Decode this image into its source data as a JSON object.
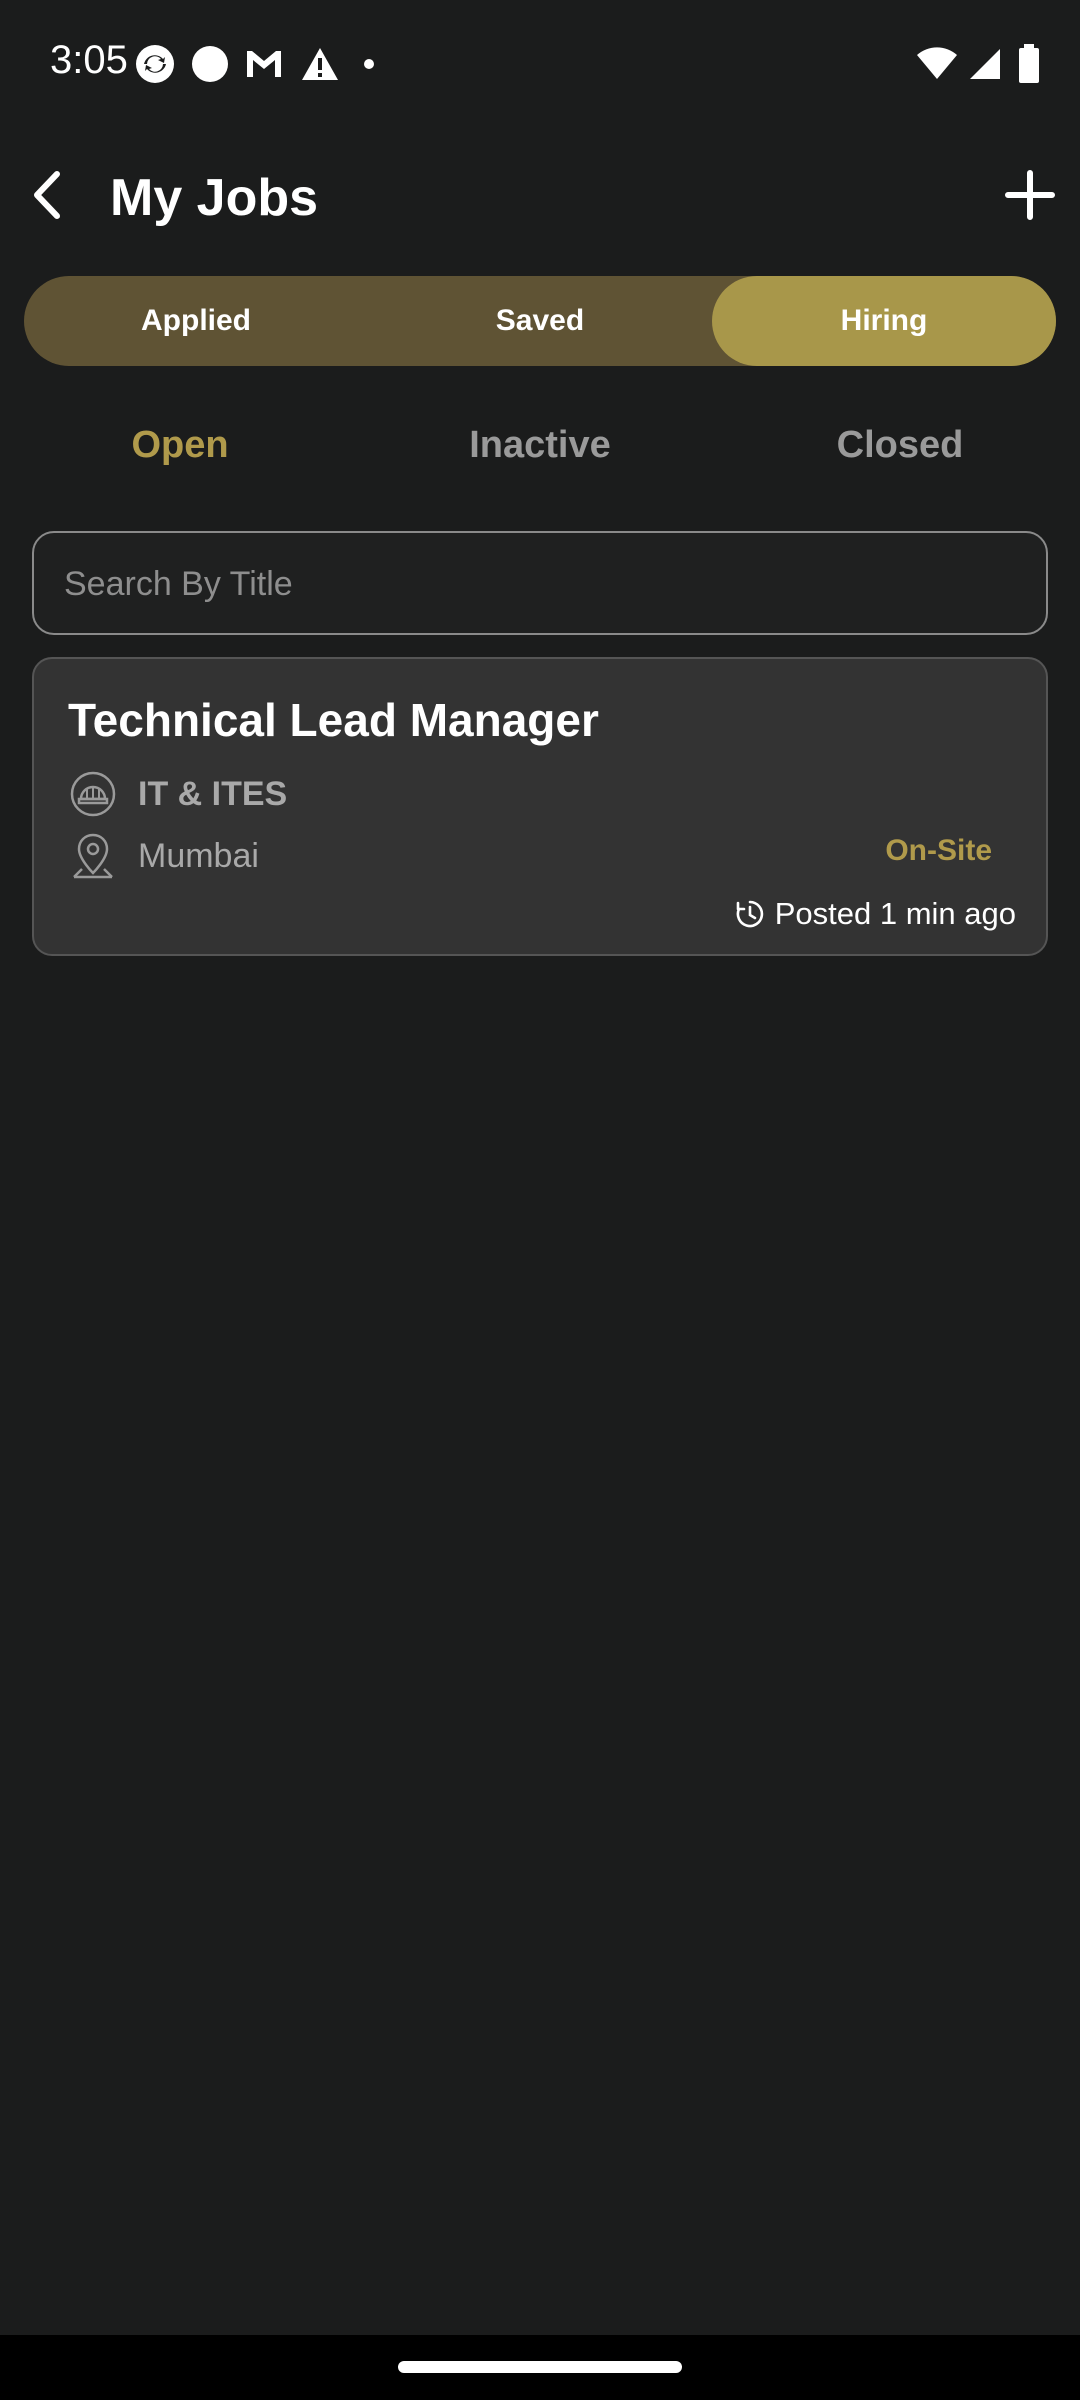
{
  "status_bar": {
    "time": "3:05",
    "left_icons": [
      "sync-icon",
      "circle-icon",
      "gmail-icon",
      "warning-icon",
      "dot-icon"
    ],
    "right_icons": [
      "wifi-icon",
      "signal-icon",
      "battery-icon"
    ]
  },
  "app_bar": {
    "title": "My Jobs",
    "back_icon": "chevron-left-icon",
    "add_icon": "plus-icon"
  },
  "segments": {
    "items": [
      {
        "label": "Applied",
        "active": false
      },
      {
        "label": "Saved",
        "active": false
      },
      {
        "label": "Hiring",
        "active": true
      }
    ]
  },
  "subtabs": {
    "items": [
      {
        "label": "Open",
        "active": true
      },
      {
        "label": "Inactive",
        "active": false
      },
      {
        "label": "Closed",
        "active": false
      }
    ]
  },
  "search": {
    "placeholder": "Search By Title",
    "value": ""
  },
  "jobs": [
    {
      "title": "Technical Lead Manager",
      "industry": "IT & ITES",
      "location": "Mumbai",
      "work_mode": "On-Site",
      "posted": "Posted 1 min ago",
      "industry_icon": "helmet-icon",
      "location_icon": "map-pin-icon",
      "posted_icon": "clock-icon"
    }
  ],
  "colors": {
    "background": "#1b1c1c",
    "accent": "#b09a4b",
    "segment_bg": "#5f5334",
    "segment_active": "#a8974a",
    "card_bg": "#333333"
  }
}
